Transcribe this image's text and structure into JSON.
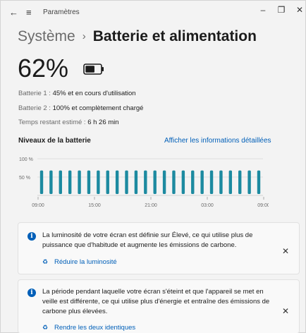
{
  "window": {
    "title": "Paramètres",
    "back_glyph": "←",
    "menu_glyph": "≡",
    "minimize_glyph": "–",
    "maximize_glyph": "❐",
    "close_glyph": "✕"
  },
  "breadcrumb": {
    "parent": "Système",
    "separator": "›",
    "current": "Batterie et alimentation"
  },
  "battery": {
    "percent_text": "62%",
    "level": 0.62,
    "battery1_label": "Batterie 1 : ",
    "battery1_value": "45% et en cours d'utilisation",
    "battery2_label": "Batterie 2 : ",
    "battery2_value": "100% et complètement chargé",
    "remaining_label": "Temps restant estimé : ",
    "remaining_value": "6 h 26 min"
  },
  "battery_levels": {
    "title": "Niveaux de la batterie",
    "details_link": "Afficher les informations détaillées"
  },
  "chart_data": {
    "type": "bar",
    "y_ticks": [
      "100 %",
      "50 %"
    ],
    "x_ticks": [
      "09:00",
      "15:00",
      "21:00",
      "03:00",
      "09:00"
    ],
    "ylim": [
      0,
      100
    ],
    "values": [
      58,
      58,
      58,
      58,
      58,
      58,
      58,
      58,
      58,
      58,
      58,
      58,
      58,
      58,
      58,
      58,
      58,
      58,
      58,
      58,
      58,
      58,
      58,
      58
    ],
    "bar_color": "#1c8aa0",
    "grid": true
  },
  "notifications": [
    {
      "text": "La luminosité de votre écran est définie sur Élevé, ce qui utilise plus de puissance que d'habitude et augmente les émissions de carbone.",
      "action": "Réduire la luminosité",
      "close_glyph": "✕"
    },
    {
      "text": "La période pendant laquelle votre écran s'éteint et que l'appareil se met en veille est différente, ce qui utilise plus d'énergie et entraîne des émissions de carbone plus élevées.",
      "action": "Rendre les deux identiques",
      "close_glyph": "✕"
    }
  ],
  "colors": {
    "accent": "#005fb8",
    "bar": "#1c8aa0"
  }
}
